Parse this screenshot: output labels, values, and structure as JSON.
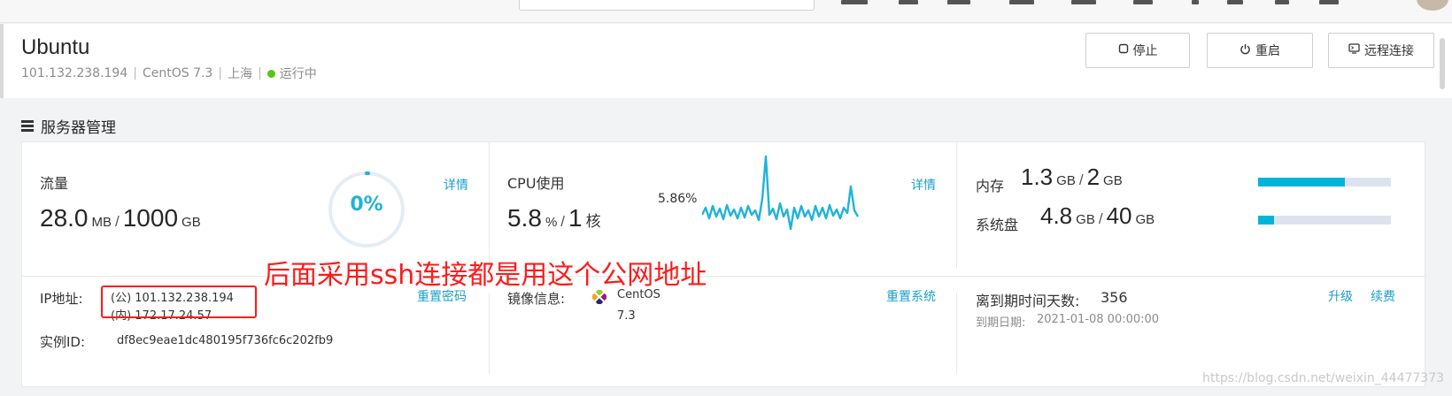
{
  "header": {
    "title": "Ubuntu",
    "ip": "101.132.238.194",
    "os": "CentOS 7.3",
    "region": "上海",
    "separator": "|",
    "status": "运行中",
    "status_color": "#52c41a",
    "buttons": {
      "stop": "停止",
      "restart": "重启",
      "remote": "远程连接"
    }
  },
  "section": {
    "title": "服务器管理"
  },
  "traffic": {
    "label": "流量",
    "used": "28.0",
    "used_unit": "MB",
    "slash": "/",
    "total": "1000",
    "total_unit": "GB",
    "percent_text": "0%",
    "percent_value": 0,
    "detail_link": "详情"
  },
  "cpu": {
    "label": "CPU使用",
    "value": "5.8",
    "unit": "%",
    "slash": "/",
    "cores": "1",
    "cores_unit": "核",
    "spark_label": "5.86%",
    "detail_link": "详情",
    "spark_color": "#1fb3d8"
  },
  "memory": {
    "label": "内存",
    "used": "1.3",
    "used_unit": "GB",
    "slash": "/",
    "total": "2",
    "total_unit": "GB",
    "fraction": 0.65
  },
  "disk": {
    "label": "系统盘",
    "used": "4.8",
    "used_unit": "GB",
    "slash": "/",
    "total": "40",
    "total_unit": "GB",
    "fraction": 0.12
  },
  "ip_info": {
    "label": "IP地址:",
    "public": "(公) 101.132.238.194",
    "private": "(内) 172.17.24.57",
    "reset_password": "重置密码",
    "instance_label": "实例ID:",
    "instance_id": "df8ec9eae1dc480195f736fc6c202fb9"
  },
  "image_info": {
    "label": "镜像信息:",
    "name": "CentOS",
    "version": "7.3",
    "reset_system": "重置系统"
  },
  "expiry": {
    "label": "离到期时间天数:",
    "days": "356",
    "date_label": "到期日期:",
    "date": "2021-01-08 00:00:00",
    "upgrade": "升级",
    "renew": "续费"
  },
  "annotation": {
    "text": "后面采用ssh连接都是用这个公网地址",
    "color": "#ff1a1a"
  },
  "watermark": "https://blog.csdn.net/weixin_44477373"
}
